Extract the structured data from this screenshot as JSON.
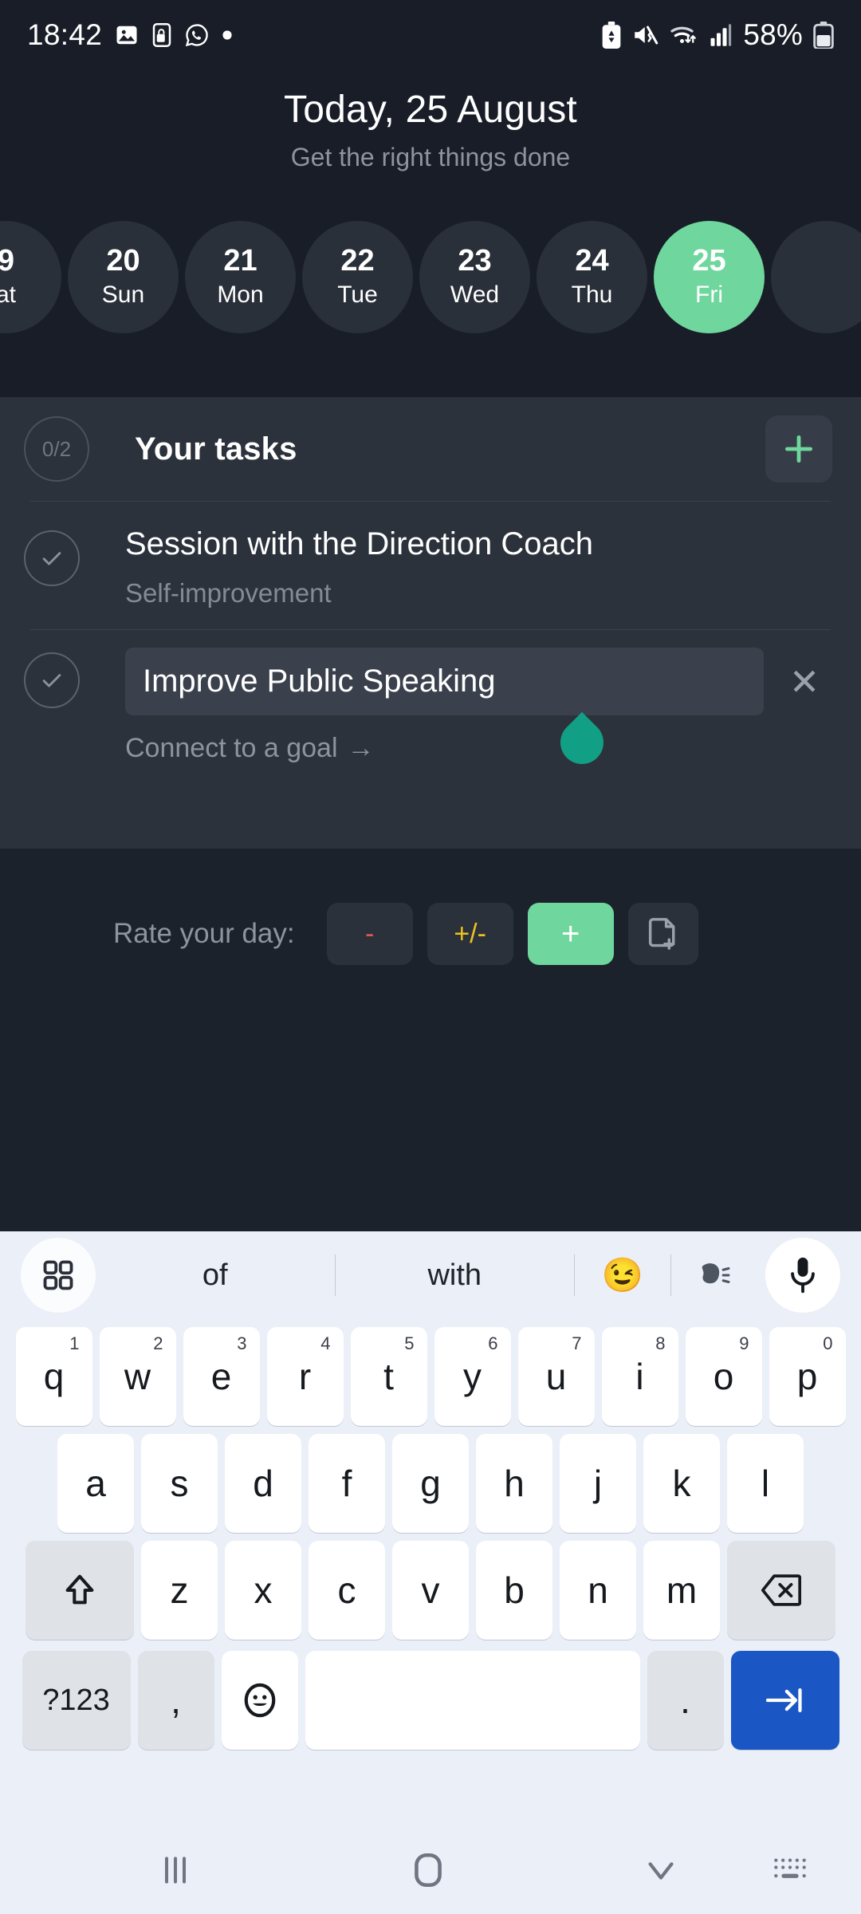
{
  "statusbar": {
    "time": "18:42",
    "battery_pct": "58%",
    "left_icons": [
      "photo-icon",
      "phone-lock-icon",
      "whatsapp-icon",
      "dot-icon"
    ],
    "right_icons": [
      "battery-saver-icon",
      "mute-icon",
      "wifi-icon",
      "signal-icon",
      "battery-icon"
    ]
  },
  "header": {
    "title": "Today, 25 August",
    "subtitle": "Get the right things done"
  },
  "dates": [
    {
      "num": "9",
      "day": "at",
      "active": false
    },
    {
      "num": "20",
      "day": "Sun",
      "active": false
    },
    {
      "num": "21",
      "day": "Mon",
      "active": false
    },
    {
      "num": "22",
      "day": "Tue",
      "active": false
    },
    {
      "num": "23",
      "day": "Wed",
      "active": false
    },
    {
      "num": "24",
      "day": "Thu",
      "active": false
    },
    {
      "num": "25",
      "day": "Fri",
      "active": true
    }
  ],
  "tasks_card": {
    "count_badge": "0/2",
    "title": "Your tasks",
    "add_label": "+",
    "items": [
      {
        "title": "Session with the Direction Coach",
        "subtitle": "Self-improvement",
        "editing": false
      },
      {
        "title": "Improve Public Speaking",
        "subtitle": "Connect to a goal",
        "subtitle_arrow": "→",
        "clear_label": "✕",
        "editing": true
      }
    ]
  },
  "rate_day": {
    "label": "Rate your day:",
    "buttons": [
      {
        "label": "-",
        "style": "neg",
        "selected": false
      },
      {
        "label": "+/-",
        "style": "mix",
        "selected": false
      },
      {
        "label": "+",
        "style": "pos",
        "selected": true
      },
      {
        "label": "",
        "style": "note",
        "selected": false,
        "icon": "note-add-icon"
      }
    ]
  },
  "keyboard": {
    "suggestions": {
      "grid_icon": "apps-grid-icon",
      "words": [
        "of",
        "with"
      ],
      "emoji": "😉",
      "voice_icon": "speech-icon",
      "mic_icon": "microphone-icon"
    },
    "row1": [
      {
        "k": "q",
        "sup": "1"
      },
      {
        "k": "w",
        "sup": "2"
      },
      {
        "k": "e",
        "sup": "3"
      },
      {
        "k": "r",
        "sup": "4"
      },
      {
        "k": "t",
        "sup": "5"
      },
      {
        "k": "y",
        "sup": "6"
      },
      {
        "k": "u",
        "sup": "7"
      },
      {
        "k": "i",
        "sup": "8"
      },
      {
        "k": "o",
        "sup": "9"
      },
      {
        "k": "p",
        "sup": "0"
      }
    ],
    "row2": [
      "a",
      "s",
      "d",
      "f",
      "g",
      "h",
      "j",
      "k",
      "l"
    ],
    "row3": [
      "z",
      "x",
      "c",
      "v",
      "b",
      "n",
      "m"
    ],
    "row3_shift": "shift-icon",
    "row3_backspace": "backspace-icon",
    "row4": {
      "num_label": "?123",
      "comma_label": ",",
      "emoji_label": "☺",
      "space_label": "",
      "period_label": ".",
      "enter_icon": "tab-next-icon"
    }
  },
  "navbar": {
    "recents": "recents-icon",
    "home": "home-icon",
    "dismiss": "chevron-down-icon",
    "keyboard_switch": "keyboard-switch-icon"
  }
}
